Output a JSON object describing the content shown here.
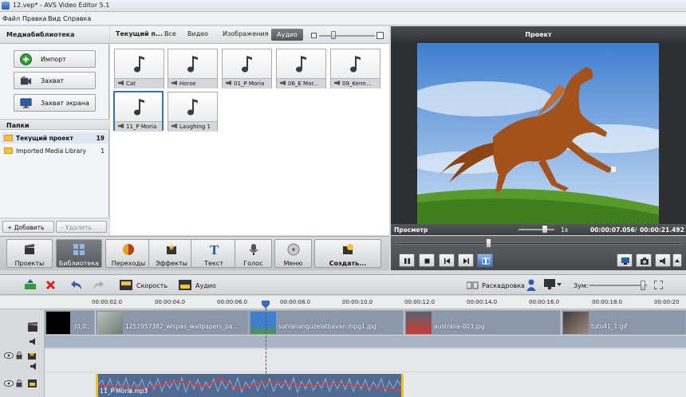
{
  "window": {
    "title": "12.vep* - AVS Video Editor 5.1"
  },
  "menu": [
    "Файл",
    "Правка",
    "Вид",
    "Справка"
  ],
  "media_library": {
    "title": "Медиабиблиотека",
    "buttons": {
      "import": "Импорт",
      "capture": "Захват",
      "screen_capture": "Захват экрана"
    },
    "folders_title": "Папки",
    "folders": [
      {
        "name": "Текущий проект",
        "count": "19"
      },
      {
        "name": "Imported Media Library",
        "count": "1"
      }
    ],
    "add_label": "+ Добавить",
    "delete_label": "– Удалить"
  },
  "browser": {
    "current_label": "Текущий п...",
    "tabs": [
      "Все",
      "Видео",
      "Изображения",
      "Аудио"
    ],
    "active_tab": "Аудио",
    "items": [
      "Cat",
      "Horse",
      "01_P Moria",
      "06_E Mor...",
      "09_Kenn...",
      "11_P Moria",
      "Laughing 1"
    ],
    "selected_item": "11_P Moria"
  },
  "preview": {
    "title": "Проект",
    "status_label": "Просмотр",
    "speed": "1x",
    "time_current": "00:00:07.056",
    "time_total": "00:00:21.492"
  },
  "toolbar": {
    "projects": "Проекты",
    "library": "Библиотека",
    "transitions": "Переходы",
    "effects": "Эффекты",
    "text": "Текст",
    "voice": "Голос",
    "menu": "Меню",
    "create": "Создать..."
  },
  "timeline_toolbar": {
    "speed": "Скорость",
    "audio": "Аудио",
    "storyboard": "Раскадровка",
    "zoom": "Зум:"
  },
  "ruler": [
    "00:00:02.0",
    "00:00:04.0",
    "00:00:06.0",
    "00:00:08.0",
    "00:00:10.0",
    "00:00:12.0",
    "00:00:14.0",
    "00:00:16.0",
    "00:00:18.0",
    "00:00:20"
  ],
  "video_clips": [
    {
      "name": "(0,0..."
    },
    {
      "name": "1252957382_wispas_wallpapers_pa..."
    },
    {
      "name": "sahlananguzelatbavan.mpg1.jpg"
    },
    {
      "name": "australia-003.jpg"
    },
    {
      "name": "tuto41_1.gif"
    }
  ],
  "audio_clip": {
    "name": "11_P Moria.mp3"
  },
  "colors": {
    "accent": "#3a6ebd",
    "audio_line": "#e23b3b",
    "playhead": "#3a6ebd"
  }
}
